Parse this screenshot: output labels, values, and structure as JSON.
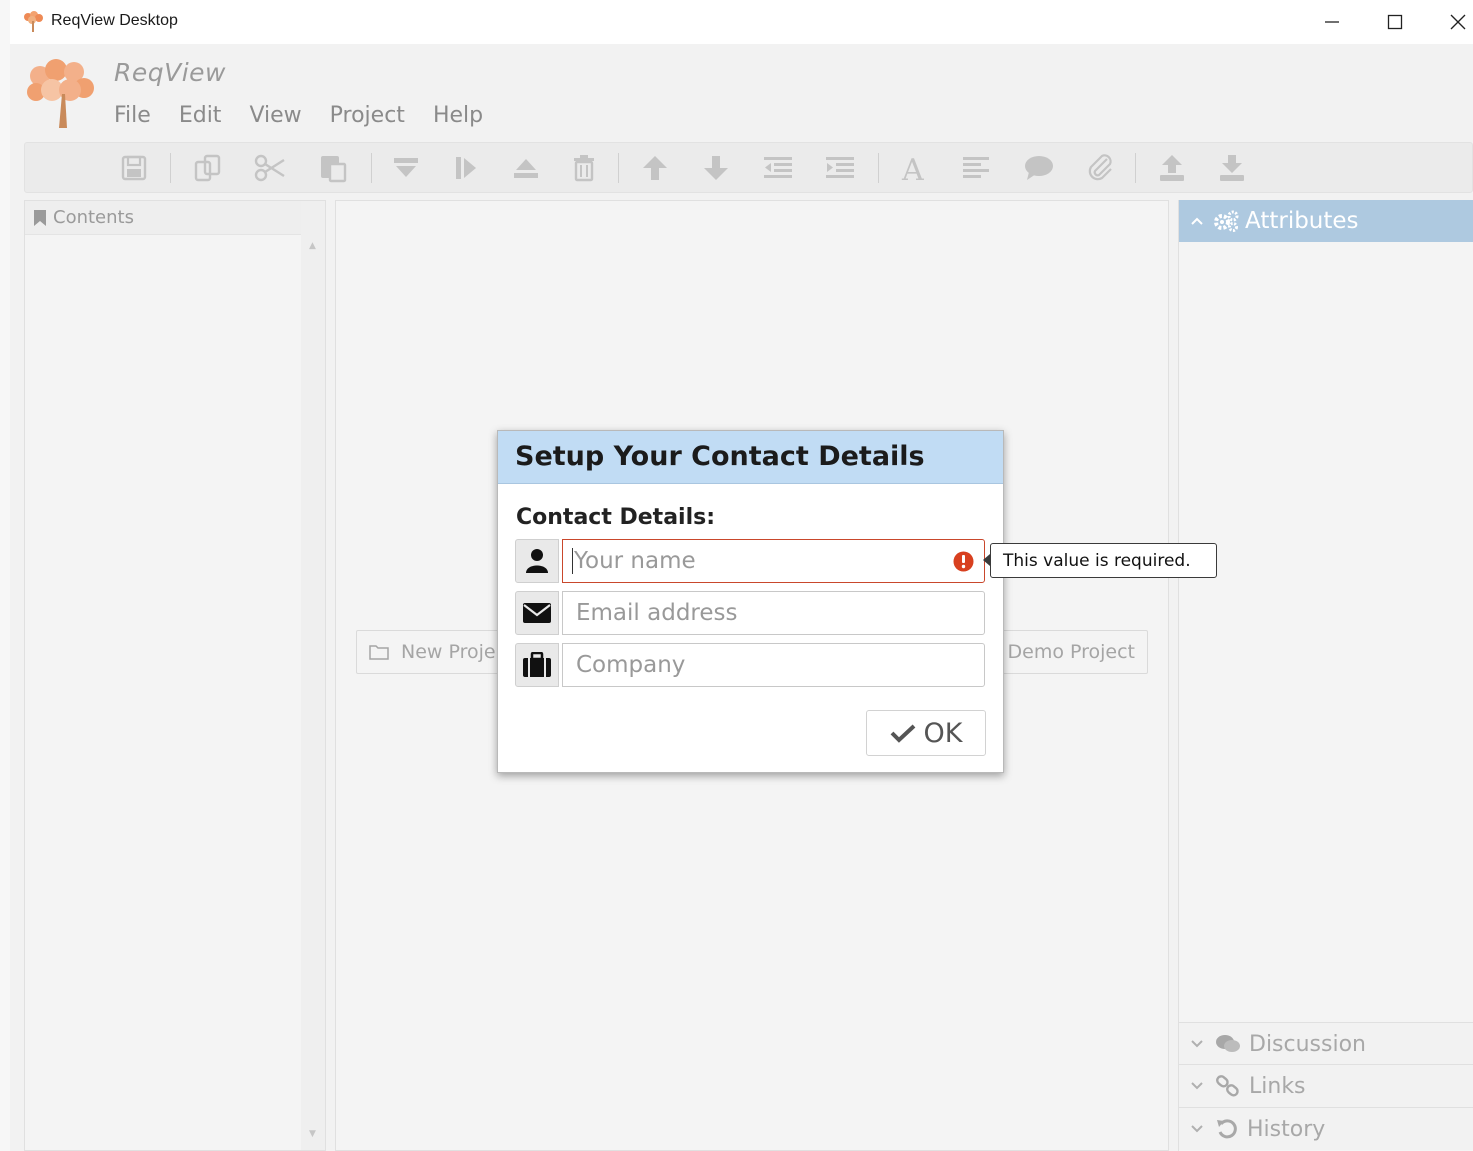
{
  "window": {
    "title": "ReqView Desktop"
  },
  "app": {
    "brand": "ReqView",
    "menu": [
      "File",
      "Edit",
      "View",
      "Project",
      "Help"
    ]
  },
  "toolbar": {
    "icons": [
      "save-icon",
      "copy-icon",
      "cut-icon",
      "paste-icon",
      "insert-below-icon",
      "insert-child-icon",
      "insert-above-icon",
      "delete-icon",
      "move-up-icon",
      "move-down-icon",
      "outdent-icon",
      "indent-icon",
      "heading-icon",
      "text-icon",
      "comment-icon",
      "attachment-icon",
      "export-icon",
      "import-icon"
    ]
  },
  "contents": {
    "label": "Contents"
  },
  "center": {
    "new_project_label": "New Proje",
    "demo_project_label": "Demo Project"
  },
  "right_panel": {
    "attributes_label": "Attributes",
    "discussion_label": "Discussion",
    "links_label": "Links",
    "history_label": "History"
  },
  "dialog": {
    "title": "Setup Your Contact Details",
    "section_label": "Contact Details:",
    "fields": [
      {
        "placeholder": "Your name",
        "value": "",
        "icon": "user-icon",
        "error": true
      },
      {
        "placeholder": "Email address",
        "value": "",
        "icon": "envelope-icon",
        "error": false
      },
      {
        "placeholder": "Company",
        "value": "",
        "icon": "briefcase-icon",
        "error": false
      }
    ],
    "validation_message": "This value is required.",
    "ok_label": "OK"
  },
  "colors": {
    "header_accent": "#c1dcf4",
    "attributes_header": "#aec9e0",
    "error": "#d8401f",
    "logo": "#f0a070"
  }
}
